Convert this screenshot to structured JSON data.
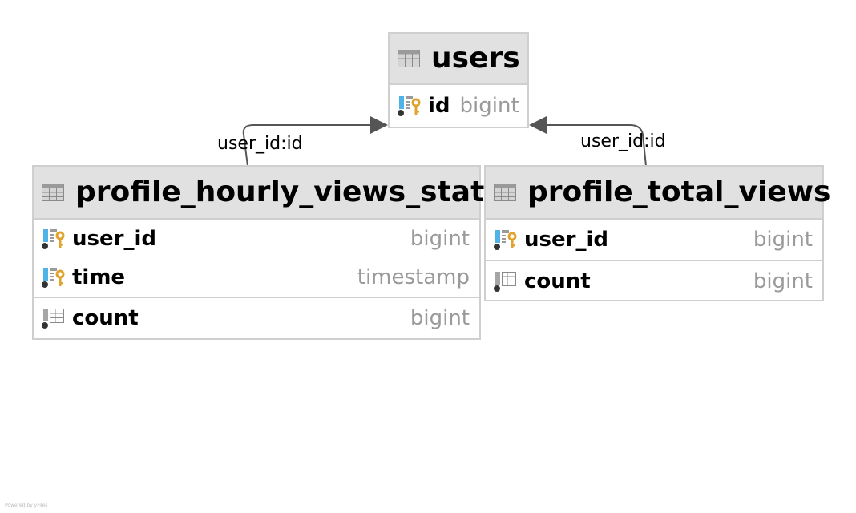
{
  "diagram": {
    "tables": {
      "users": {
        "title": "users",
        "columns": [
          {
            "name": "id",
            "type": "bigint",
            "icon": "primary-foreign-key-icon"
          }
        ]
      },
      "hourly": {
        "title": "profile_hourly_views_stats",
        "key_columns": [
          {
            "name": "user_id",
            "type": "bigint",
            "icon": "primary-foreign-key-icon"
          },
          {
            "name": "time",
            "type": "timestamp",
            "icon": "primary-key-icon"
          }
        ],
        "other_columns": [
          {
            "name": "count",
            "type": "bigint",
            "icon": "column-icon"
          }
        ]
      },
      "total": {
        "title": "profile_total_views",
        "key_columns": [
          {
            "name": "user_id",
            "type": "bigint",
            "icon": "primary-foreign-key-icon"
          }
        ],
        "other_columns": [
          {
            "name": "count",
            "type": "bigint",
            "icon": "column-icon"
          }
        ]
      }
    },
    "relations": [
      {
        "from": "profile_hourly_views_stats",
        "to": "users",
        "label": "user_id:id"
      },
      {
        "from": "profile_total_views",
        "to": "users",
        "label": "user_id:id"
      }
    ],
    "watermark": "Powered by yFiles",
    "colors": {
      "header_bg": "#e1e1e1",
      "border": "#cfcfcf",
      "type_text": "#9a9a9a",
      "key_gold": "#e0a32e",
      "fk_blue": "#4fb3e8",
      "edge": "#555555"
    }
  }
}
